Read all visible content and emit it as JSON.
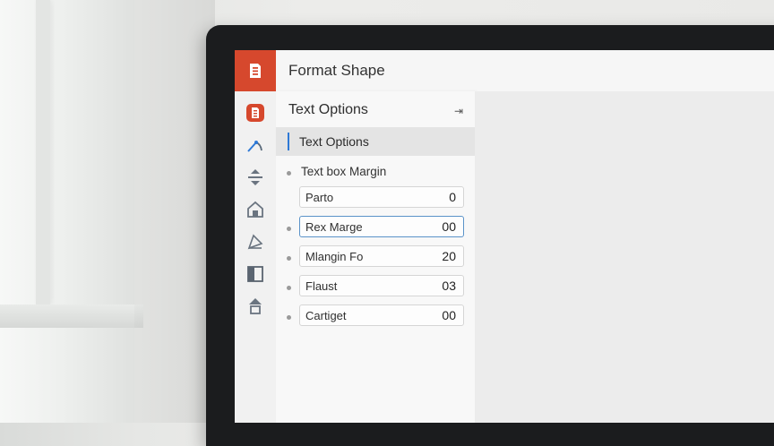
{
  "window": {
    "title": "Format Shape"
  },
  "panel": {
    "title": "Text Options",
    "active_tab": "Text Options",
    "section": "Text box Margin",
    "fields": [
      {
        "label": "Parto",
        "value": "0",
        "selected": false
      },
      {
        "label": "Rex Marge",
        "value": "00",
        "selected": true
      },
      {
        "label": "Mlangin Fo",
        "value": "20",
        "selected": false
      },
      {
        "label": "Flaust",
        "value": "03",
        "selected": false
      },
      {
        "label": "Cartiget",
        "value": "00",
        "selected": false
      }
    ]
  },
  "icons": {
    "app": "presentation-app-icon",
    "rail": [
      "shape-icon",
      "line-curve-icon",
      "align-icon",
      "home-shape-icon",
      "edit-shape-icon",
      "layout-icon",
      "arrange-icon"
    ],
    "collapse": "collapse-icon"
  },
  "colors": {
    "accent": "#d6482d",
    "selection": "#2e79d6"
  }
}
